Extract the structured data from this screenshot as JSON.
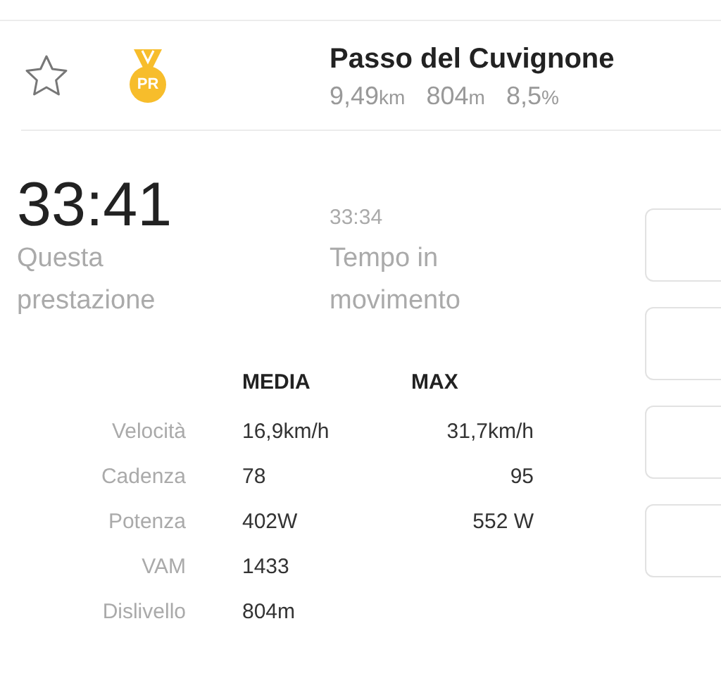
{
  "segment": {
    "starred": false,
    "badge": "PR",
    "title": "Passo del Cuvignone",
    "stats": [
      {
        "value": "9,49",
        "unit": "km"
      },
      {
        "value": "804",
        "unit": "m"
      },
      {
        "value": "8,5",
        "unit": "%"
      }
    ]
  },
  "times": [
    {
      "kind": "main",
      "value": "33:41",
      "label": "Questa prestazione"
    },
    {
      "kind": "secondary",
      "value": "33:34",
      "label": "Tempo in movimento"
    }
  ],
  "table": {
    "columns": [
      "MEDIA",
      "MAX"
    ],
    "rows": [
      {
        "label": "Velocità",
        "media": "16,9km/h",
        "max": "31,7km/h"
      },
      {
        "label": "Cadenza",
        "media": "78",
        "max": "95"
      },
      {
        "label": "Potenza",
        "media": "402W",
        "max": "552 W"
      },
      {
        "label": "VAM",
        "media": "1433"
      },
      {
        "label": "Dislivello",
        "media": "804m"
      }
    ]
  },
  "side_cards": [
    {
      "kind": "panel"
    },
    {
      "kind": "panel"
    },
    {
      "kind": "panel"
    },
    {
      "kind": "panel"
    }
  ]
}
